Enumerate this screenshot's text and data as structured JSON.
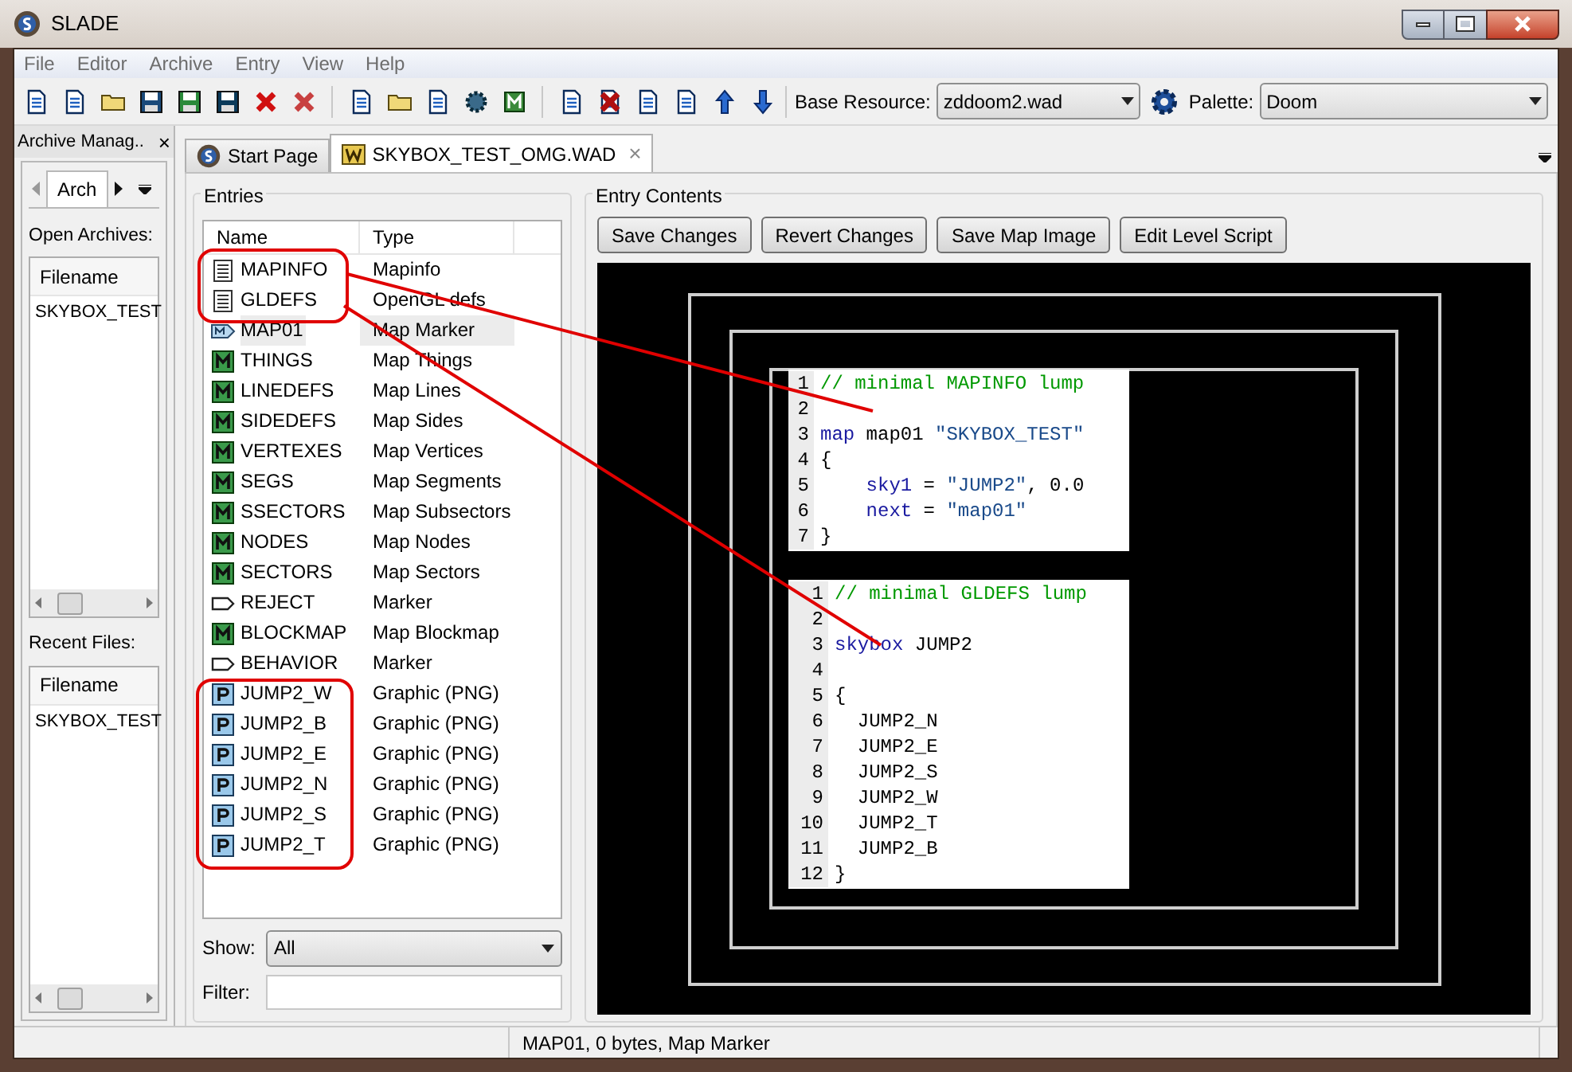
{
  "window": {
    "title": "SLADE"
  },
  "menu": [
    "File",
    "Editor",
    "Archive",
    "Entry",
    "View",
    "Help"
  ],
  "toolbar": {
    "base_resource_label": "Base Resource:",
    "base_resource": "zddoom2.wad",
    "palette_label": "Palette:",
    "palette": "Doom"
  },
  "archive_manager": {
    "title": "Archive Manag..",
    "close": "×",
    "tab": "Arch",
    "open_label": "Open Archives:",
    "open_column": "Filename",
    "open_files": [
      "SKYBOX_TEST"
    ],
    "recent_label": "Recent Files:",
    "recent_column": "Filename",
    "recent_files": [
      "SKYBOX_TEST"
    ]
  },
  "tabs": [
    {
      "label": "Start Page",
      "kind": "start",
      "selected": false
    },
    {
      "label": "SKYBOX_TEST_OMG.WAD",
      "kind": "wad",
      "selected": true,
      "close": "×"
    }
  ],
  "entries": {
    "title": "Entries",
    "columns": [
      "Name",
      "Type"
    ],
    "rows": [
      {
        "name": "MAPINFO",
        "type": "Mapinfo",
        "kind": "text",
        "selected": false
      },
      {
        "name": "GLDEFS",
        "type": "OpenGL defs",
        "kind": "text",
        "selected": false
      },
      {
        "name": "MAP01",
        "type": "Map Marker",
        "kind": "mapmarker",
        "selected": true
      },
      {
        "name": "THINGS",
        "type": "Map Things",
        "kind": "map",
        "selected": false
      },
      {
        "name": "LINEDEFS",
        "type": "Map Lines",
        "kind": "map",
        "selected": false
      },
      {
        "name": "SIDEDEFS",
        "type": "Map Sides",
        "kind": "map",
        "selected": false
      },
      {
        "name": "VERTEXES",
        "type": "Map Vertices",
        "kind": "map",
        "selected": false
      },
      {
        "name": "SEGS",
        "type": "Map Segments",
        "kind": "map",
        "selected": false
      },
      {
        "name": "SSECTORS",
        "type": "Map Subsectors",
        "kind": "map",
        "selected": false
      },
      {
        "name": "NODES",
        "type": "Map Nodes",
        "kind": "map",
        "selected": false
      },
      {
        "name": "SECTORS",
        "type": "Map Sectors",
        "kind": "map",
        "selected": false
      },
      {
        "name": "REJECT",
        "type": "Marker",
        "kind": "marker",
        "selected": false
      },
      {
        "name": "BLOCKMAP",
        "type": "Map Blockmap",
        "kind": "map",
        "selected": false
      },
      {
        "name": "BEHAVIOR",
        "type": "Marker",
        "kind": "marker",
        "selected": false
      },
      {
        "name": "JUMP2_W",
        "type": "Graphic (PNG)",
        "kind": "png",
        "selected": false
      },
      {
        "name": "JUMP2_B",
        "type": "Graphic (PNG)",
        "kind": "png",
        "selected": false
      },
      {
        "name": "JUMP2_E",
        "type": "Graphic (PNG)",
        "kind": "png",
        "selected": false
      },
      {
        "name": "JUMP2_N",
        "type": "Graphic (PNG)",
        "kind": "png",
        "selected": false
      },
      {
        "name": "JUMP2_S",
        "type": "Graphic (PNG)",
        "kind": "png",
        "selected": false
      },
      {
        "name": "JUMP2_T",
        "type": "Graphic (PNG)",
        "kind": "png",
        "selected": false
      }
    ],
    "show_label": "Show:",
    "show_value": "All",
    "filter_label": "Filter:"
  },
  "entry_contents": {
    "title": "Entry Contents",
    "buttons": [
      "Save Changes",
      "Revert Changes",
      "Save Map Image",
      "Edit Level Script"
    ],
    "code_panels": [
      {
        "lines": [
          {
            "number": "1",
            "tokens": [
              {
                "kind": "comment",
                "text": "// minimal MAPINFO lump"
              }
            ]
          },
          {
            "number": "2"
          },
          {
            "number": "3",
            "tokens": [
              {
                "kind": "keyword",
                "text": "map"
              },
              {
                "kind": "plain",
                "text": " map01 "
              },
              {
                "kind": "string",
                "text": "\"SKYBOX_TEST\""
              }
            ]
          },
          {
            "number": "4",
            "tokens": [
              {
                "kind": "plain",
                "text": "{"
              }
            ]
          },
          {
            "number": "5",
            "tokens": [
              {
                "kind": "keyword",
                "text": "    sky1"
              },
              {
                "kind": "plain",
                "text": " = "
              },
              {
                "kind": "string",
                "text": "\"JUMP2\""
              },
              {
                "kind": "plain",
                "text": ", 0.0"
              }
            ]
          },
          {
            "number": "6",
            "tokens": [
              {
                "kind": "keyword",
                "text": "    next"
              },
              {
                "kind": "plain",
                "text": " = "
              },
              {
                "kind": "string",
                "text": "\"map01\""
              }
            ]
          },
          {
            "number": "7",
            "tokens": [
              {
                "kind": "plain",
                "text": "}"
              }
            ]
          }
        ]
      },
      {
        "lines": [
          {
            "number": "1",
            "tokens": [
              {
                "kind": "comment",
                "text": "// minimal GLDEFS lump"
              }
            ]
          },
          {
            "number": "2"
          },
          {
            "number": "3",
            "tokens": [
              {
                "kind": "keyword",
                "text": "skybox"
              },
              {
                "kind": "plain",
                "text": " JUMP2"
              }
            ]
          },
          {
            "number": "4"
          },
          {
            "number": "5",
            "tokens": [
              {
                "kind": "plain",
                "text": "{"
              }
            ]
          },
          {
            "number": "6",
            "tokens": [
              {
                "kind": "plain",
                "text": "  JUMP2_N"
              }
            ]
          },
          {
            "number": "7",
            "tokens": [
              {
                "kind": "plain",
                "text": "  JUMP2_E"
              }
            ]
          },
          {
            "number": "8",
            "tokens": [
              {
                "kind": "plain",
                "text": "  JUMP2_S"
              }
            ]
          },
          {
            "number": "9",
            "tokens": [
              {
                "kind": "plain",
                "text": "  JUMP2_W"
              }
            ]
          },
          {
            "number": "10",
            "tokens": [
              {
                "kind": "plain",
                "text": "  JUMP2_T"
              }
            ]
          },
          {
            "number": "11",
            "tokens": [
              {
                "kind": "plain",
                "text": "  JUMP2_B"
              }
            ]
          },
          {
            "number": "12",
            "tokens": [
              {
                "kind": "plain",
                "text": "}"
              }
            ]
          }
        ]
      }
    ]
  },
  "status_bar": "MAP01, 0 bytes, Map Marker"
}
